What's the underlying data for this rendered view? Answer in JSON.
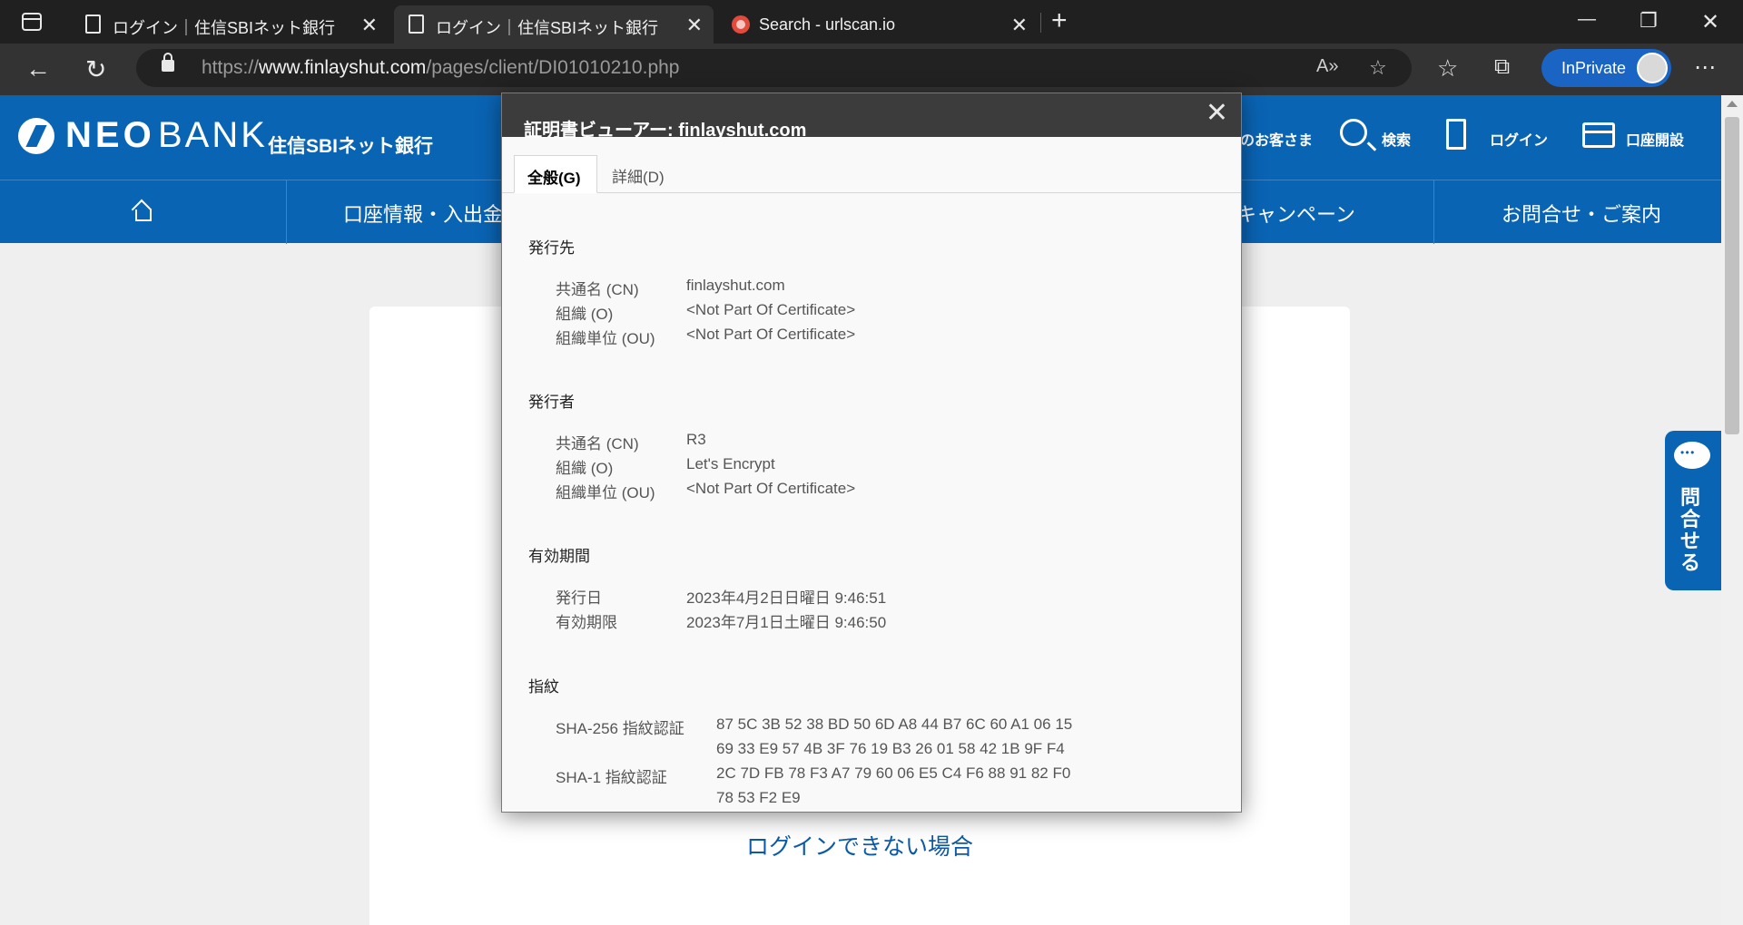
{
  "browser": {
    "tabs": [
      {
        "title": "ログイン｜住信SBIネット銀行",
        "active": false
      },
      {
        "title": "ログイン｜住信SBIネット銀行",
        "active": true
      },
      {
        "title": "Search - urlscan.io",
        "active": false
      }
    ],
    "url_prefix": "https://",
    "url_host": "www.finlayshut.com",
    "url_path": "/pages/client/DI01010210.php",
    "inprivate_label": "InPrivate"
  },
  "site": {
    "logo_neo": "NEO",
    "logo_bank": "BANK",
    "logo_jp": "住信SBIネット銀行",
    "header_links": {
      "customer": "のお客さま",
      "search": "検索",
      "login": "ログイン",
      "open_account": "口座開設"
    },
    "nav": {
      "account": "口座情報・入出金",
      "campaign": "キャンペーン",
      "contact": "お問合せ・ご案内"
    },
    "cant_login_link": "ログインできない場合",
    "contact_tab": "問合せる"
  },
  "cert": {
    "title": "証明書ビューアー: finlayshut.com",
    "tabs": {
      "general": "全般(G)",
      "details": "詳細(D)"
    },
    "issued_to": {
      "heading": "発行先",
      "rows": [
        {
          "k": "共通名 (CN)",
          "v": "finlayshut.com"
        },
        {
          "k": "組織 (O)",
          "v": "<Not Part Of Certificate>"
        },
        {
          "k": "組織単位 (OU)",
          "v": "<Not Part Of Certificate>"
        }
      ]
    },
    "issued_by": {
      "heading": "発行者",
      "rows": [
        {
          "k": "共通名 (CN)",
          "v": "R3"
        },
        {
          "k": "組織 (O)",
          "v": "Let's Encrypt"
        },
        {
          "k": "組織単位 (OU)",
          "v": "<Not Part Of Certificate>"
        }
      ]
    },
    "validity": {
      "heading": "有効期間",
      "rows": [
        {
          "k": "発行日",
          "v": "2023年4月2日日曜日 9:46:51"
        },
        {
          "k": "有効期限",
          "v": "2023年7月1日土曜日 9:46:50"
        }
      ]
    },
    "fingerprints": {
      "heading": "指紋",
      "sha256_label": "SHA-256 指紋認証",
      "sha256_line1": "87 5C 3B 52 38 BD 50 6D A8 44 B7 6C 60 A1 06 15",
      "sha256_line2": "69 33 E9 57 4B 3F 76 19 B3 26 01 58 42 1B 9F F4",
      "sha1_label": "SHA-1 指紋認証",
      "sha1_line1": "2C 7D FB 78 F3 A7 79 60 06 E5 C4 F6 88 91 82 F0",
      "sha1_line2": "78 53 F2 E9"
    }
  }
}
